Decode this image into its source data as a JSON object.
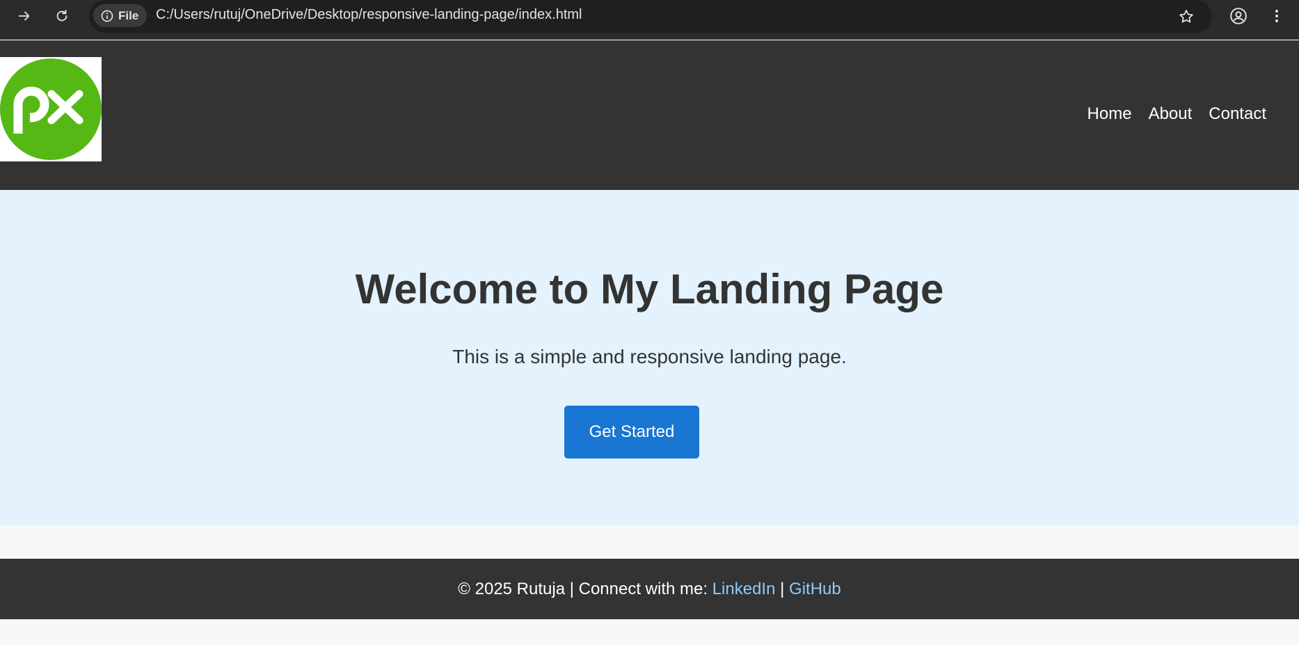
{
  "browser": {
    "site_chip_label": "File",
    "url": "C:/Users/rutuj/OneDrive/Desktop/responsive-landing-page/index.html"
  },
  "header": {
    "logo_text": "px",
    "nav": [
      "Home",
      "About",
      "Contact"
    ]
  },
  "hero": {
    "title": "Welcome to My Landing Page",
    "subtitle": "This is a simple and responsive landing page.",
    "cta_label": "Get Started"
  },
  "footer": {
    "copyright": "© 2025 Rutuja | Connect with me: ",
    "linkedin": "LinkedIn",
    "separator": " | ",
    "github": "GitHub"
  },
  "colors": {
    "header_bg": "#333333",
    "hero_bg": "#e3f2fd",
    "button_bg": "#1976d2",
    "link": "#90caf9",
    "logo_green": "#56b814"
  }
}
